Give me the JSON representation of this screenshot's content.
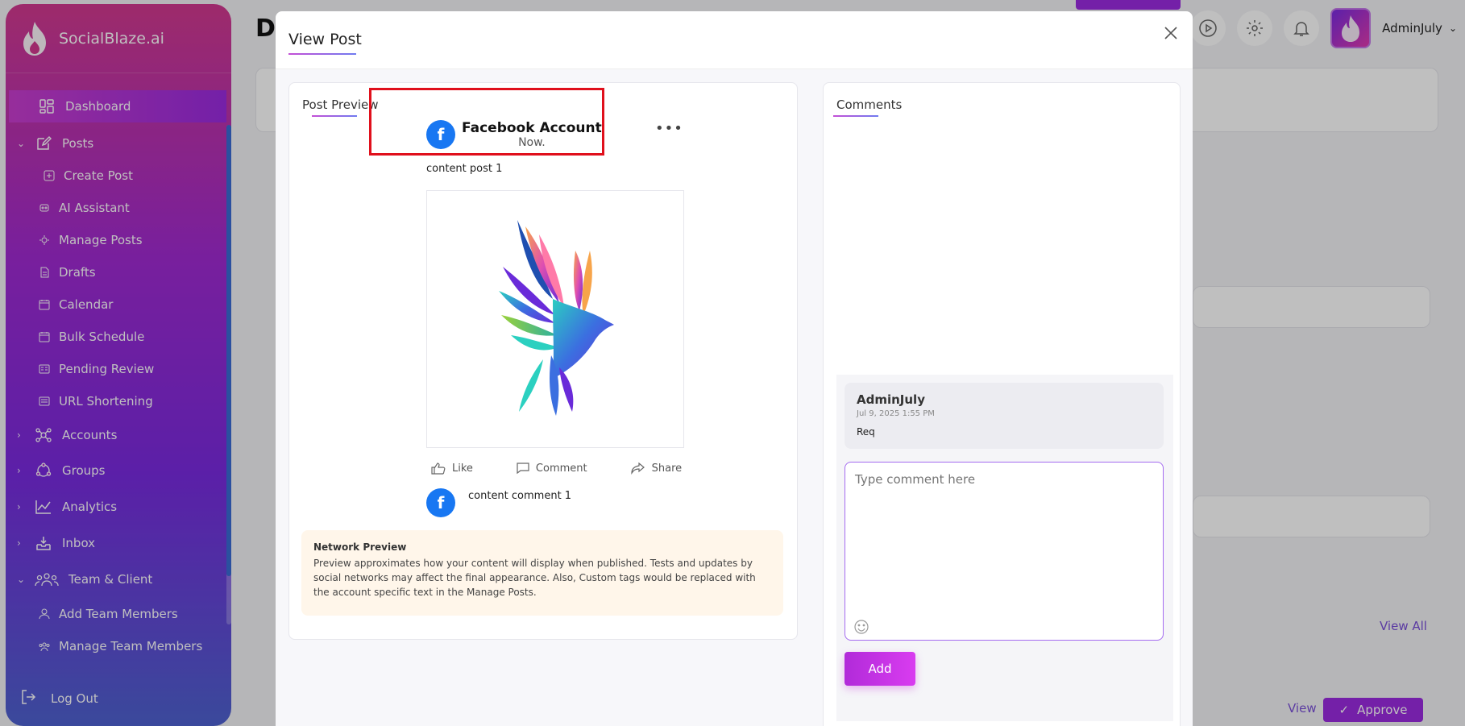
{
  "brand": {
    "name": "SocialBlaze.ai"
  },
  "sidebar": {
    "items": [
      {
        "label": "Dashboard",
        "icon": "dashboard-icon",
        "level": "top",
        "active": true
      },
      {
        "label": "Posts",
        "icon": "edit-icon",
        "level": "top",
        "chevron": "down"
      },
      {
        "label": "Create Post",
        "icon": "create-post-icon",
        "level": "sub"
      },
      {
        "label": "AI Assistant",
        "icon": "ai-icon",
        "level": "sub"
      },
      {
        "label": "Manage Posts",
        "icon": "manage-icon",
        "level": "sub"
      },
      {
        "label": "Drafts",
        "icon": "drafts-icon",
        "level": "sub"
      },
      {
        "label": "Calendar",
        "icon": "calendar-icon",
        "level": "sub"
      },
      {
        "label": "Bulk Schedule",
        "icon": "calendar-icon",
        "level": "sub"
      },
      {
        "label": "Pending Review",
        "icon": "review-icon",
        "level": "sub"
      },
      {
        "label": "URL Shortening",
        "icon": "link-icon",
        "level": "sub"
      },
      {
        "label": "Accounts",
        "icon": "accounts-icon",
        "level": "top",
        "chevron": "right"
      },
      {
        "label": "Groups",
        "icon": "groups-icon",
        "level": "top",
        "chevron": "right"
      },
      {
        "label": "Analytics",
        "icon": "analytics-icon",
        "level": "top",
        "chevron": "right"
      },
      {
        "label": "Inbox",
        "icon": "inbox-icon",
        "level": "top",
        "chevron": "right"
      },
      {
        "label": "Team & Client",
        "icon": "team-icon",
        "level": "top",
        "chevron": "down"
      },
      {
        "label": "Add Team Members",
        "icon": "add-user-icon",
        "level": "sub"
      },
      {
        "label": "Manage Team Members",
        "icon": "manage-team-icon",
        "level": "sub"
      }
    ],
    "logout_label": "Log Out"
  },
  "header": {
    "page_title": "De",
    "user_name": "AdminJuly"
  },
  "background": {
    "view_all": "View All",
    "view": "View",
    "approve": "Approve"
  },
  "modal": {
    "title": "View Post",
    "preview": {
      "title": "Post Preview",
      "account_name": "Facebook Account",
      "account_time": "Now.",
      "post_text": "content post 1",
      "actions": {
        "like": "Like",
        "comment": "Comment",
        "share": "Share"
      },
      "comment_text": "content comment 1",
      "network_title": "Network Preview",
      "network_body": "Preview approximates how your content will display when published. Tests and updates by social networks may affect the final appearance. Also, Custom tags would be replaced with the account specific text in the Manage Posts."
    },
    "comments": {
      "title": "Comments",
      "items": [
        {
          "user": "AdminJuly",
          "date": "Jul 9, 2025 1:55 PM",
          "text": "Req"
        }
      ],
      "input_placeholder": "Type comment here",
      "add_label": "Add"
    }
  },
  "colors": {
    "accent": "#9b2be0",
    "facebook": "#1877f2",
    "highlight": "#e0101c"
  }
}
